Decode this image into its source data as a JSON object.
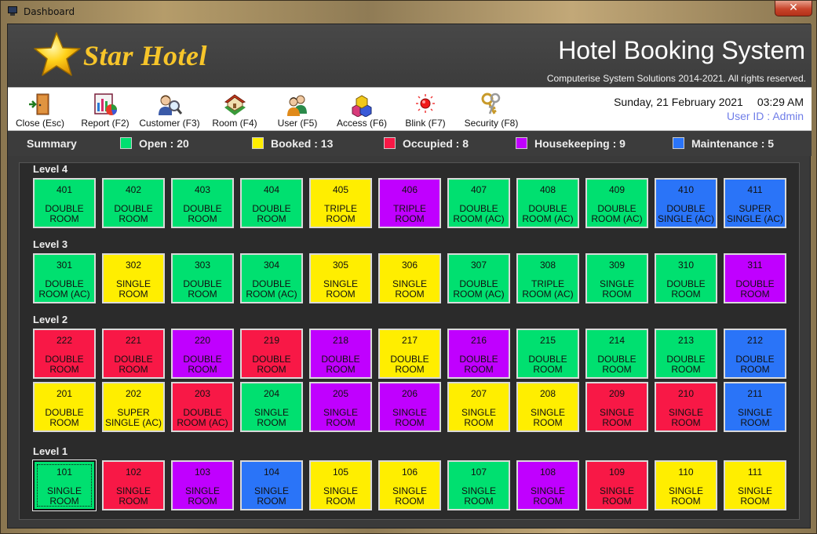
{
  "window": {
    "title": "Dashboard",
    "close_glyph": "✕"
  },
  "header": {
    "brand": "Star Hotel",
    "title": "Hotel Booking System",
    "copyright": "Computerise System Solutions 2014-2021. All rights reserved."
  },
  "toolbar": {
    "buttons": [
      {
        "label": "Close (Esc)",
        "icon": "exit-door-icon"
      },
      {
        "label": "Report (F2)",
        "icon": "report-chart-icon"
      },
      {
        "label": "Customer (F3)",
        "icon": "customer-search-icon"
      },
      {
        "label": "Room (F4)",
        "icon": "room-house-icon"
      },
      {
        "label": "User (F5)",
        "icon": "users-icon"
      },
      {
        "label": "Access (F6)",
        "icon": "access-cubes-icon"
      },
      {
        "label": "Blink (F7)",
        "icon": "blink-light-icon"
      },
      {
        "label": "Security (F8)",
        "icon": "security-keys-icon"
      }
    ],
    "date": "Sunday, 21 February 2021",
    "time": "03:29 AM",
    "user": "User ID : Admin"
  },
  "summary": {
    "title": "Summary",
    "items": [
      {
        "label": "Open : 20",
        "status": "open"
      },
      {
        "label": "Booked : 13",
        "status": "booked"
      },
      {
        "label": "Occupied : 8",
        "status": "occupied"
      },
      {
        "label": "Housekeeping : 9",
        "status": "housekeeping"
      },
      {
        "label": "Maintenance : 5",
        "status": "maintenance"
      }
    ]
  },
  "colors": {
    "open": "#00e070",
    "booked": "#ffee00",
    "occupied": "#f81846",
    "housekeeping": "#c000ff",
    "maintenance": "#2a74f8"
  },
  "levels": [
    {
      "name": "Level 4",
      "rows": [
        [
          {
            "number": "401",
            "type": "DOUBLE ROOM",
            "status": "open"
          },
          {
            "number": "402",
            "type": "DOUBLE ROOM",
            "status": "open"
          },
          {
            "number": "403",
            "type": "DOUBLE ROOM",
            "status": "open"
          },
          {
            "number": "404",
            "type": "DOUBLE ROOM",
            "status": "open"
          },
          {
            "number": "405",
            "type": "TRIPLE ROOM",
            "status": "booked"
          },
          {
            "number": "406",
            "type": "TRIPLE ROOM",
            "status": "housekeeping"
          },
          {
            "number": "407",
            "type": "DOUBLE ROOM (AC)",
            "status": "open"
          },
          {
            "number": "408",
            "type": "DOUBLE ROOM (AC)",
            "status": "open"
          },
          {
            "number": "409",
            "type": "DOUBLE ROOM (AC)",
            "status": "open"
          },
          {
            "number": "410",
            "type": "DOUBLE SINGLE (AC)",
            "status": "maintenance"
          },
          {
            "number": "411",
            "type": "SUPER SINGLE (AC)",
            "status": "maintenance"
          }
        ]
      ]
    },
    {
      "name": "Level 3",
      "rows": [
        [
          {
            "number": "301",
            "type": "DOUBLE ROOM (AC)",
            "status": "open"
          },
          {
            "number": "302",
            "type": "SINGLE ROOM",
            "status": "booked"
          },
          {
            "number": "303",
            "type": "DOUBLE ROOM",
            "status": "open"
          },
          {
            "number": "304",
            "type": "DOUBLE ROOM (AC)",
            "status": "open"
          },
          {
            "number": "305",
            "type": "SINGLE ROOM",
            "status": "booked"
          },
          {
            "number": "306",
            "type": "SINGLE ROOM",
            "status": "booked"
          },
          {
            "number": "307",
            "type": "DOUBLE ROOM (AC)",
            "status": "open"
          },
          {
            "number": "308",
            "type": "TRIPLE ROOM (AC)",
            "status": "open"
          },
          {
            "number": "309",
            "type": "SINGLE ROOM",
            "status": "open"
          },
          {
            "number": "310",
            "type": "DOUBLE ROOM",
            "status": "open"
          },
          {
            "number": "311",
            "type": "DOUBLE ROOM",
            "status": "housekeeping"
          }
        ]
      ]
    },
    {
      "name": "Level 2",
      "rows": [
        [
          {
            "number": "222",
            "type": "DOUBLE ROOM",
            "status": "occupied"
          },
          {
            "number": "221",
            "type": "DOUBLE ROOM",
            "status": "occupied"
          },
          {
            "number": "220",
            "type": "DOUBLE ROOM",
            "status": "housekeeping"
          },
          {
            "number": "219",
            "type": "DOUBLE ROOM",
            "status": "occupied"
          },
          {
            "number": "218",
            "type": "DOUBLE ROOM",
            "status": "housekeeping"
          },
          {
            "number": "217",
            "type": "DOUBLE ROOM",
            "status": "booked"
          },
          {
            "number": "216",
            "type": "DOUBLE ROOM",
            "status": "housekeeping"
          },
          {
            "number": "215",
            "type": "DOUBLE ROOM",
            "status": "open"
          },
          {
            "number": "214",
            "type": "DOUBLE ROOM",
            "status": "open"
          },
          {
            "number": "213",
            "type": "DOUBLE ROOM",
            "status": "open"
          },
          {
            "number": "212",
            "type": "DOUBLE ROOM",
            "status": "maintenance"
          }
        ],
        [
          {
            "number": "201",
            "type": "DOUBLE ROOM",
            "status": "booked"
          },
          {
            "number": "202",
            "type": "SUPER SINGLE (AC)",
            "status": "booked"
          },
          {
            "number": "203",
            "type": "DOUBLE ROOM (AC)",
            "status": "occupied"
          },
          {
            "number": "204",
            "type": "SINGLE ROOM",
            "status": "open"
          },
          {
            "number": "205",
            "type": "SINGLE ROOM",
            "status": "housekeeping"
          },
          {
            "number": "206",
            "type": "SINGLE ROOM",
            "status": "housekeeping"
          },
          {
            "number": "207",
            "type": "SINGLE ROOM",
            "status": "booked"
          },
          {
            "number": "208",
            "type": "SINGLE ROOM",
            "status": "booked"
          },
          {
            "number": "209",
            "type": "SINGLE ROOM",
            "status": "occupied"
          },
          {
            "number": "210",
            "type": "SINGLE ROOM",
            "status": "occupied"
          },
          {
            "number": "211",
            "type": "SINGLE ROOM",
            "status": "maintenance"
          }
        ]
      ]
    },
    {
      "name": "Level 1",
      "rows": [
        [
          {
            "number": "101",
            "type": "SINGLE ROOM",
            "status": "open",
            "selected": true
          },
          {
            "number": "102",
            "type": "SINGLE ROOM",
            "status": "occupied"
          },
          {
            "number": "103",
            "type": "SINGLE ROOM",
            "status": "housekeeping"
          },
          {
            "number": "104",
            "type": "SINGLE ROOM",
            "status": "maintenance"
          },
          {
            "number": "105",
            "type": "SINGLE ROOM",
            "status": "booked"
          },
          {
            "number": "106",
            "type": "SINGLE ROOM",
            "status": "booked"
          },
          {
            "number": "107",
            "type": "SINGLE ROOM",
            "status": "open"
          },
          {
            "number": "108",
            "type": "SINGLE ROOM",
            "status": "housekeeping"
          },
          {
            "number": "109",
            "type": "SINGLE ROOM",
            "status": "occupied"
          },
          {
            "number": "110",
            "type": "SINGLE ROOM",
            "status": "booked"
          },
          {
            "number": "111",
            "type": "SINGLE ROOM",
            "status": "booked"
          }
        ]
      ]
    }
  ]
}
